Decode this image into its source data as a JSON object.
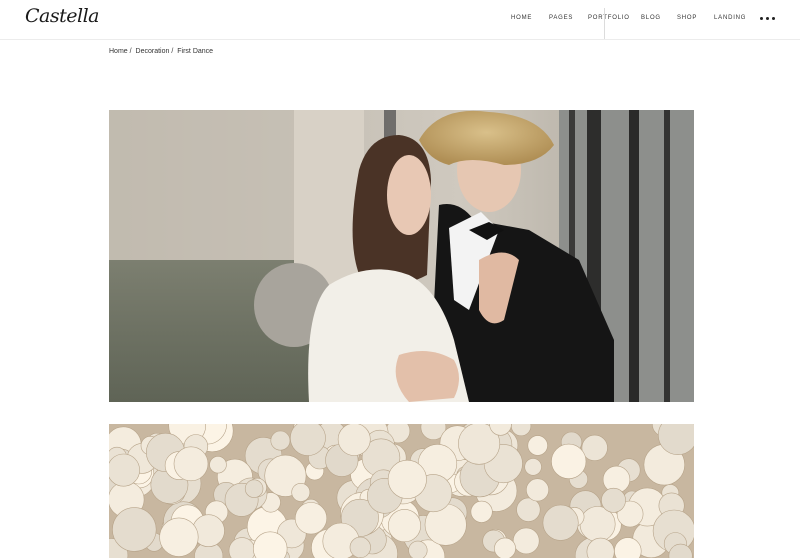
{
  "header": {
    "logo": "Castella",
    "nav": [
      {
        "label": "HOME"
      },
      {
        "label": "PAGES"
      },
      {
        "label": "PORTFOLIO"
      },
      {
        "label": "BLOG"
      },
      {
        "label": "SHOP"
      },
      {
        "label": "LANDING"
      }
    ],
    "more_icon": "ellipsis-icon"
  },
  "breadcrumb": {
    "items": [
      "Home",
      "Decoration",
      "First Dance"
    ],
    "separator": "/"
  },
  "gallery": {
    "images": [
      {
        "subject": "couple-embracing-photo"
      },
      {
        "subject": "white-flowers-photo"
      }
    ]
  },
  "colors": {
    "text": "#333333",
    "border": "#ececec",
    "background": "#ffffff"
  }
}
